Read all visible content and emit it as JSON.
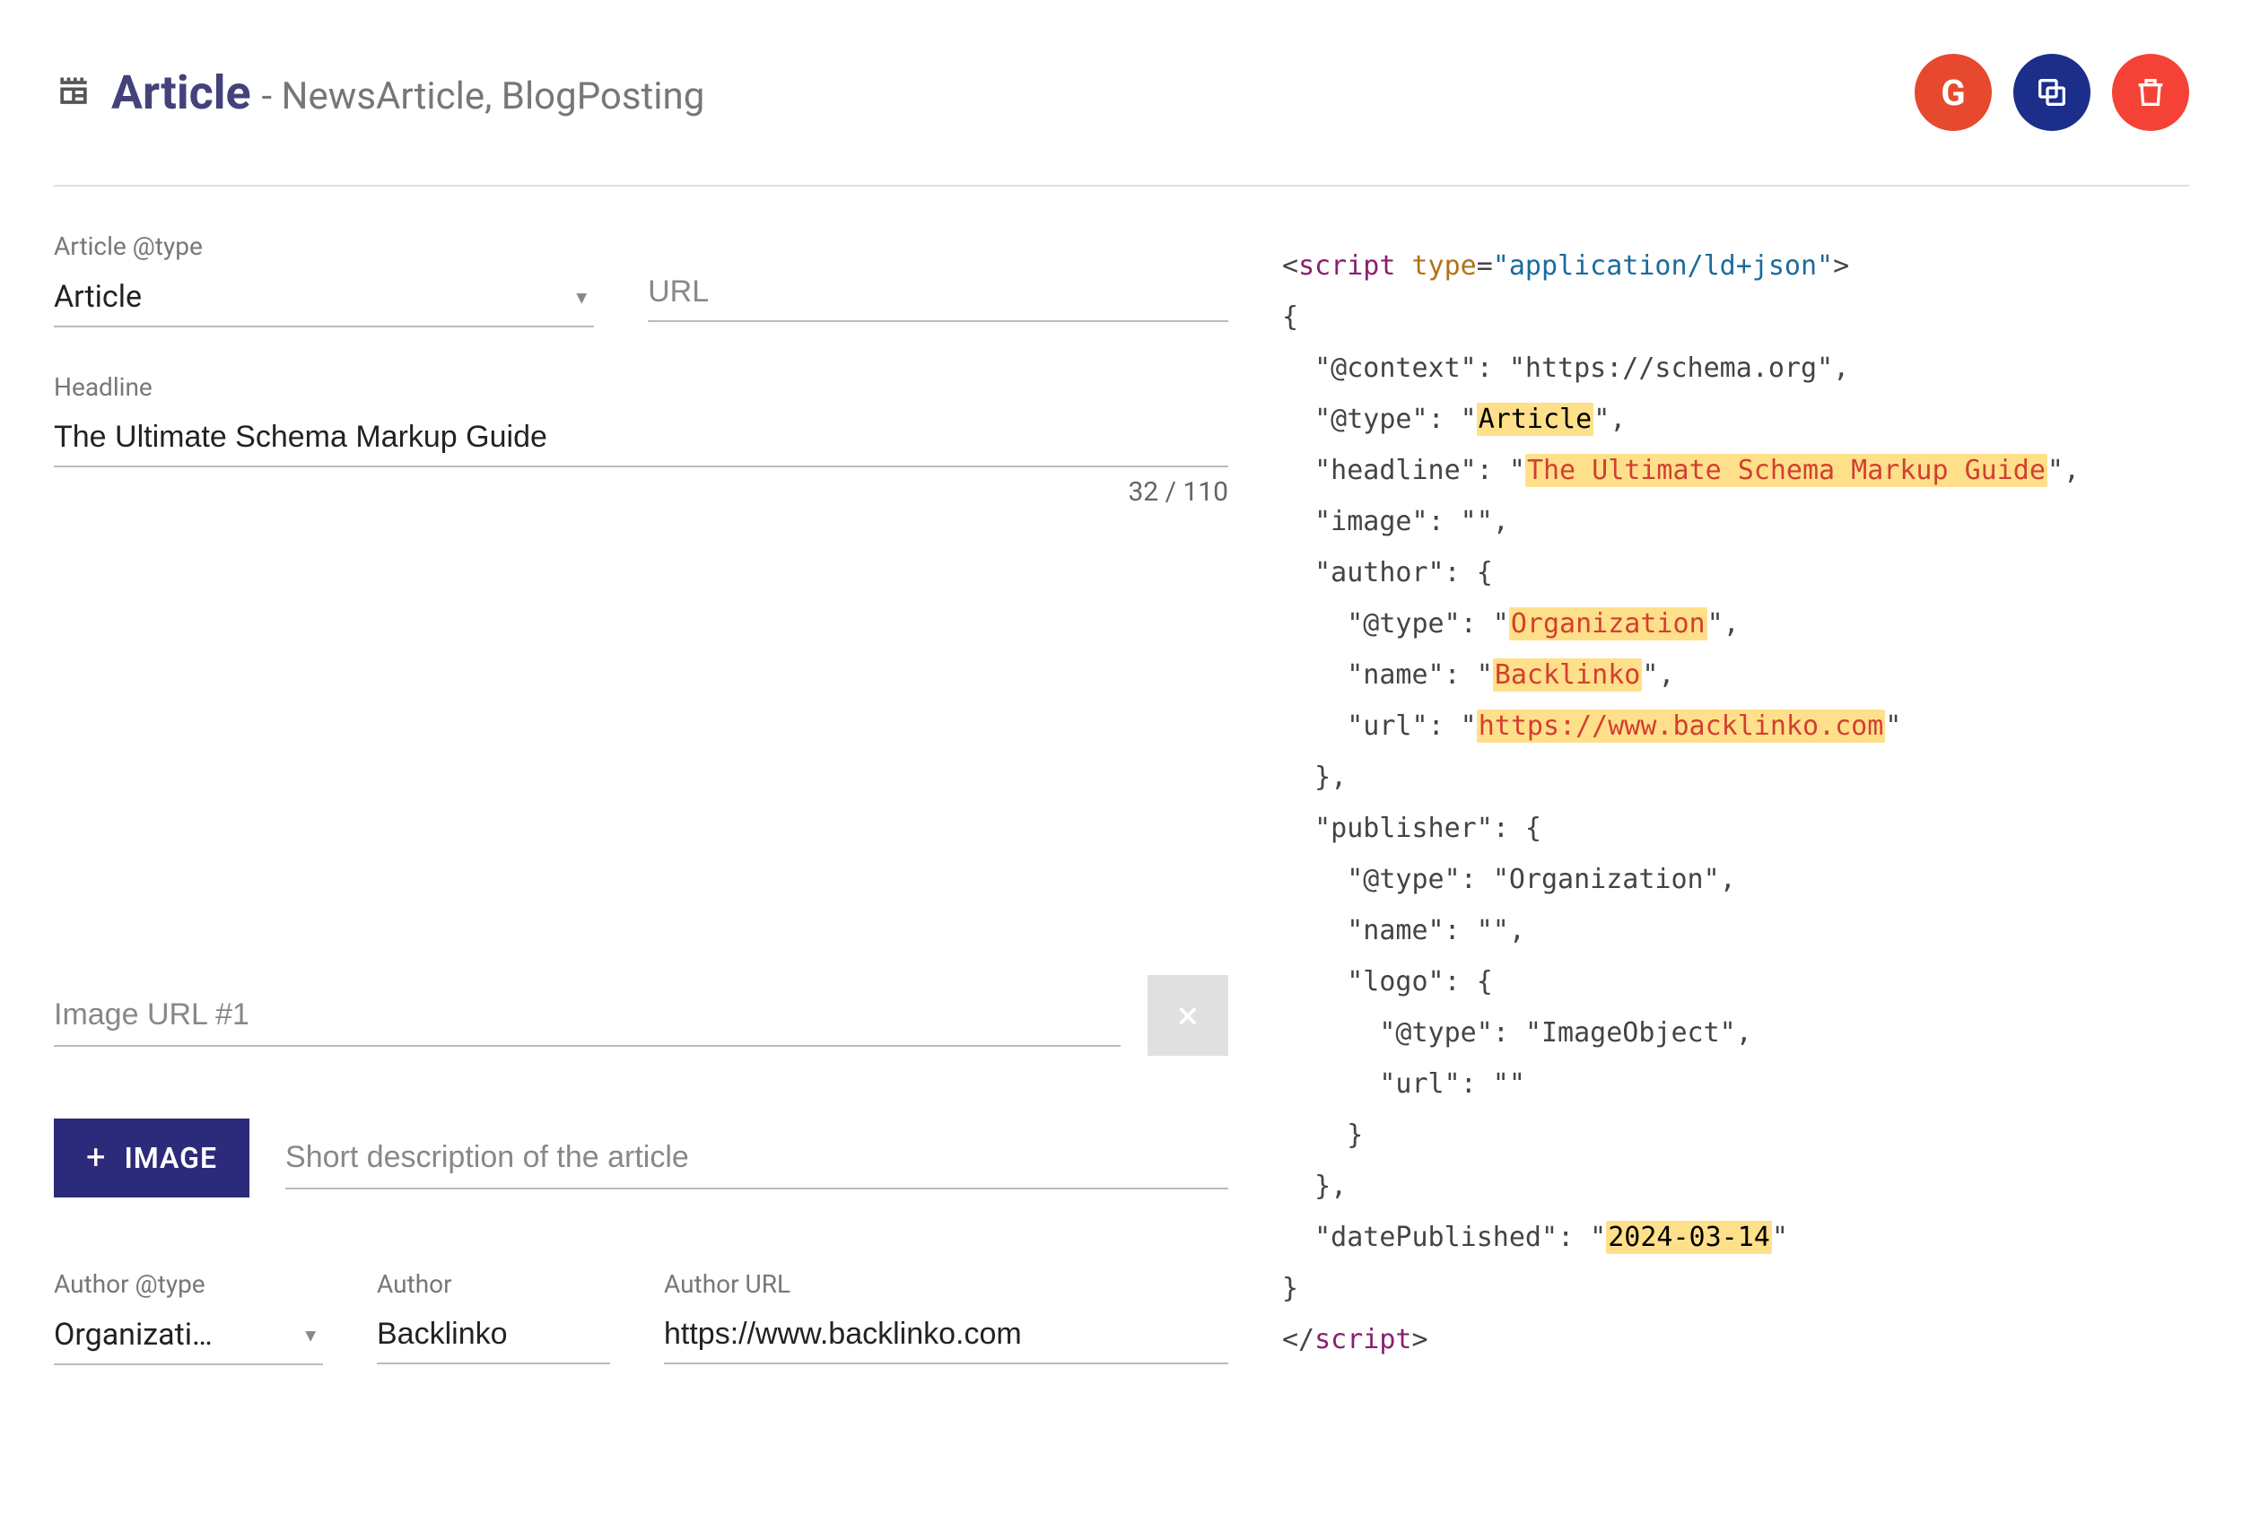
{
  "header": {
    "title": "Article",
    "subtitle": "- NewsArticle, BlogPosting"
  },
  "actions": {
    "google": "G",
    "copy": "copy",
    "delete": "delete"
  },
  "form": {
    "article_type": {
      "label": "Article @type",
      "value": "Article"
    },
    "url": {
      "placeholder": "URL",
      "value": ""
    },
    "headline": {
      "label": "Headline",
      "value": "The Ultimate Schema Markup Guide",
      "count": "32 / 110"
    },
    "image1": {
      "placeholder": "Image URL #1",
      "value": ""
    },
    "add_image_btn": "IMAGE",
    "description": {
      "placeholder": "Short description of the article",
      "value": ""
    },
    "author_type": {
      "label": "Author @type",
      "value": "Organizati…"
    },
    "author_name": {
      "label": "Author",
      "value": "Backlinko"
    },
    "author_url": {
      "label": "Author URL",
      "value": "https://www.backlinko.com"
    }
  },
  "code": {
    "script_open_tag": "script",
    "script_type_attr": "type",
    "script_type_val": "\"application/ld+json\"",
    "context_key": "\"@context\"",
    "context_val": "\"https://schema.org\"",
    "type_key": "\"@type\"",
    "type_val": "Article",
    "headline_key": "\"headline\"",
    "headline_val": "The Ultimate Schema Markup Guide",
    "image_key": "\"image\"",
    "author_key": "\"author\"",
    "author_type_val": "Organization",
    "name_key": "\"name\"",
    "author_name_val": "Backlinko",
    "url_key": "\"url\"",
    "author_url_val": "https://www.backlinko.com",
    "publisher_key": "\"publisher\"",
    "pub_type_val": "\"Organization\"",
    "logo_key": "\"logo\"",
    "logo_type_val": "\"ImageObject\"",
    "date_key": "\"datePublished\"",
    "date_val": "2024-03-14",
    "script_close": "script"
  }
}
